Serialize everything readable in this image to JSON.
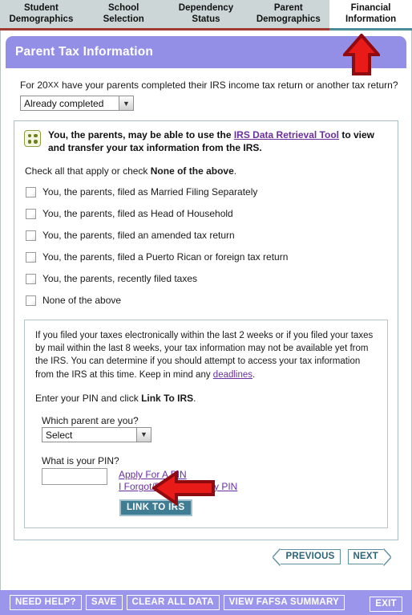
{
  "tabs": [
    {
      "name": "tab-student-demographics",
      "line1": "Student",
      "line2": "Demographics",
      "active": false
    },
    {
      "name": "tab-school-selection",
      "line1": "School",
      "line2": "Selection",
      "active": false
    },
    {
      "name": "tab-dependency-status",
      "line1": "Dependency",
      "line2": "Status",
      "active": false
    },
    {
      "name": "tab-parent-demographics",
      "line1": "Parent",
      "line2": "Demographics",
      "active": false
    },
    {
      "name": "tab-financial-information",
      "line1": "Financial",
      "line2": "Information",
      "active": true
    }
  ],
  "section": {
    "title": "Parent Tax Information"
  },
  "tax_question": {
    "text_before": "For 20",
    "year_placeholder": "XX",
    "text_after": " have your parents completed their IRS income tax return or another tax return?",
    "dropdown_value": "Already completed",
    "dropdown_arrow": "chevron-down-icon"
  },
  "irs_notice": {
    "icon": "dice-info-icon",
    "text_before": "You, the parents, may be able to use the ",
    "link_text": "IRS Data Retrieval Tool",
    "text_after": " to view and transfer your tax information from the IRS."
  },
  "check_instruction": {
    "text_before": "Check all that apply or check ",
    "bold_text": "None of the above",
    "text_after": "."
  },
  "checkboxes": [
    {
      "label": "You, the parents, filed as Married Filing Separately",
      "checked": false
    },
    {
      "label": "You, the parents, filed as Head of Household",
      "checked": false
    },
    {
      "label": "You, the parents, filed an amended tax return",
      "checked": false
    },
    {
      "label": "You, the parents, filed a Puerto Rican or foreign tax return",
      "checked": false
    },
    {
      "label": "You, the parents, recently filed taxes",
      "checked": false
    },
    {
      "label": "None of the above",
      "checked": false
    }
  ],
  "note_box": {
    "paragraph_before_link": "If you filed your taxes electronically within the last 2 weeks or if you filed your taxes by mail within the last 8 weeks, your tax information may not be available yet from the IRS. You can determine if you should attempt to access your tax information from the IRS at this time. Keep in mind any ",
    "link_text": "deadlines",
    "paragraph_after_link": ".",
    "pin_instruction_before": "Enter your PIN and click ",
    "pin_instruction_bold": "Link To IRS",
    "pin_instruction_after": "."
  },
  "parent_select": {
    "label": "Which parent are you?",
    "value": "Select",
    "arrow": "chevron-down-icon"
  },
  "pin_field": {
    "label": "What is your PIN?",
    "value": "",
    "placeholder": ""
  },
  "pin_links": [
    {
      "label": "Apply For A PIN",
      "name": "apply-for-pin-link"
    },
    {
      "label": "I Forgot/Don't Know My PIN",
      "name": "forgot-pin-link"
    }
  ],
  "link_to_irs_button": {
    "label": "LINK TO IRS"
  },
  "navigation": {
    "previous_label": "PREVIOUS",
    "next_label": "NEXT"
  },
  "bottom_bar": {
    "buttons": [
      {
        "label": "NEED HELP?",
        "name": "need-help-button"
      },
      {
        "label": "SAVE",
        "name": "save-button"
      },
      {
        "label": "CLEAR ALL DATA",
        "name": "clear-all-data-button"
      },
      {
        "label": "VIEW FAFSA SUMMARY",
        "name": "view-fafsa-summary-button"
      }
    ],
    "exit_label": "EXIT"
  },
  "annotations": [
    {
      "name": "red-arrow-up-icon",
      "direction": "up",
      "target": "tab-financial-information"
    },
    {
      "name": "red-arrow-left-icon",
      "direction": "left",
      "target": "parent-select-dropdown"
    }
  ],
  "colors": {
    "header_purple": "#948fe6",
    "bottom_purple": "#9b95ec",
    "tab_bar": "#ccd6d6",
    "tab_underline_inactive": "#a13b32",
    "tab_underline_active": "#4a8c99",
    "link_purple": "#6b2fa0",
    "button_teal": "#3f7d94",
    "arrow_red": "#e81b18",
    "arrow_red_dark": "#8f0b10"
  }
}
